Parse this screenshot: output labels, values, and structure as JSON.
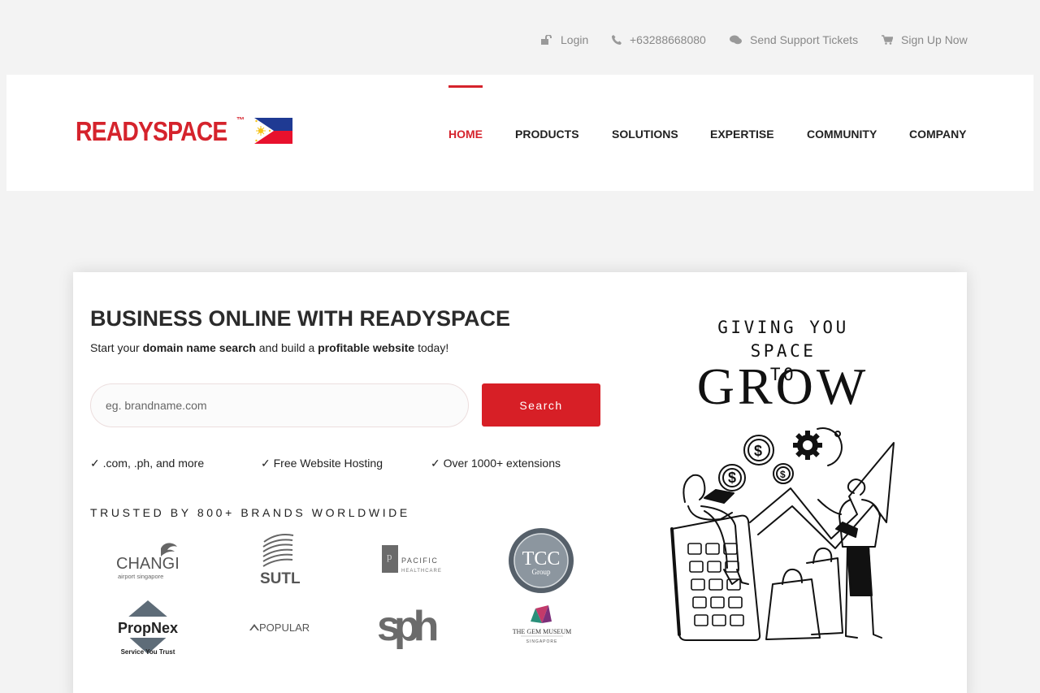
{
  "topbar": {
    "login": "Login",
    "phone": "+63288668080",
    "support": "Send Support Tickets",
    "signup": "Sign Up Now",
    "icons": [
      "lock-icon",
      "phone-icon",
      "chat-icon",
      "cart-icon"
    ]
  },
  "header": {
    "logo_text": "READYSPACE",
    "logo_tm": "™",
    "nav": [
      "HOME",
      "PRODUCTS",
      "SOLUTIONS",
      "EXPERTISE",
      "COMMUNITY",
      "COMPANY"
    ],
    "active_nav": "HOME"
  },
  "hero": {
    "headline": "BUSINESS ONLINE WITH READYSPACE",
    "tagline_parts": [
      "Start your ",
      "domain name search",
      " and build a ",
      "profitable website",
      " today!"
    ],
    "search_placeholder": "eg. brandname.com",
    "search_button": "Search",
    "features": [
      "✓ .com, .ph, and more",
      "✓ Free Website Hosting",
      "✓ Over 1000+ extensions"
    ],
    "trusted": "TRUSTED BY 800+ BRANDS WORLDWIDE"
  },
  "brands": {
    "changi": "CHANGI",
    "changi_sub": "airport singapore",
    "sutl": "SUTL",
    "pacific": "PACIFIC",
    "pacific_sub": "HEALTHCARE",
    "tcc": "TCC",
    "tcc_sub": "Group",
    "propnex": "PropNex",
    "propnex_sub": "Service You Trust",
    "popular": "POPULAR",
    "sph": "sph",
    "gem": "THE GEM MUSEUM",
    "gem_sub": "SINGAPORE"
  },
  "promo": {
    "line1": "GIVING YOU SPACE",
    "line2": "TO",
    "line3": "GROW"
  },
  "colors": {
    "accent": "#d71f26",
    "background": "#f3f3f3"
  }
}
